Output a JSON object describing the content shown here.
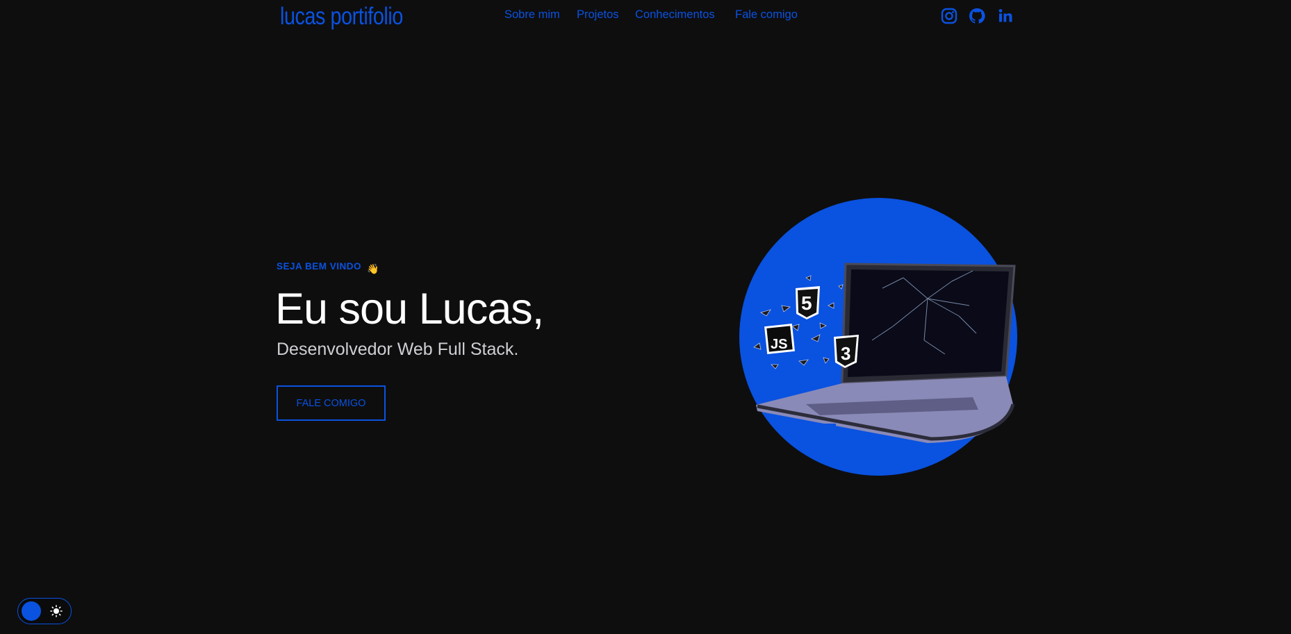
{
  "header": {
    "logo": "lucas portifolio",
    "nav": [
      {
        "label": "Sobre mim"
      },
      {
        "label": "Projetos"
      },
      {
        "label": "Conhecimentos"
      },
      {
        "label": "Fale comigo"
      }
    ],
    "social": [
      "instagram-icon",
      "github-icon",
      "linkedin-icon"
    ]
  },
  "hero": {
    "kicker": "SEJA BEM VINDO",
    "kicker_emoji": "👋",
    "headline": "Eu sou Lucas,",
    "subline": "Desenvolvedor Web Full Stack.",
    "cta": "FALE COMIGO",
    "art_badges": [
      "5",
      "JS",
      "3"
    ]
  },
  "theme_toggle": {
    "icon": "sun-icon"
  },
  "colors": {
    "background": "#0e0e0f",
    "accent": "#0a52e0",
    "headline": "#ffffff",
    "subline": "#cfcfd4"
  }
}
